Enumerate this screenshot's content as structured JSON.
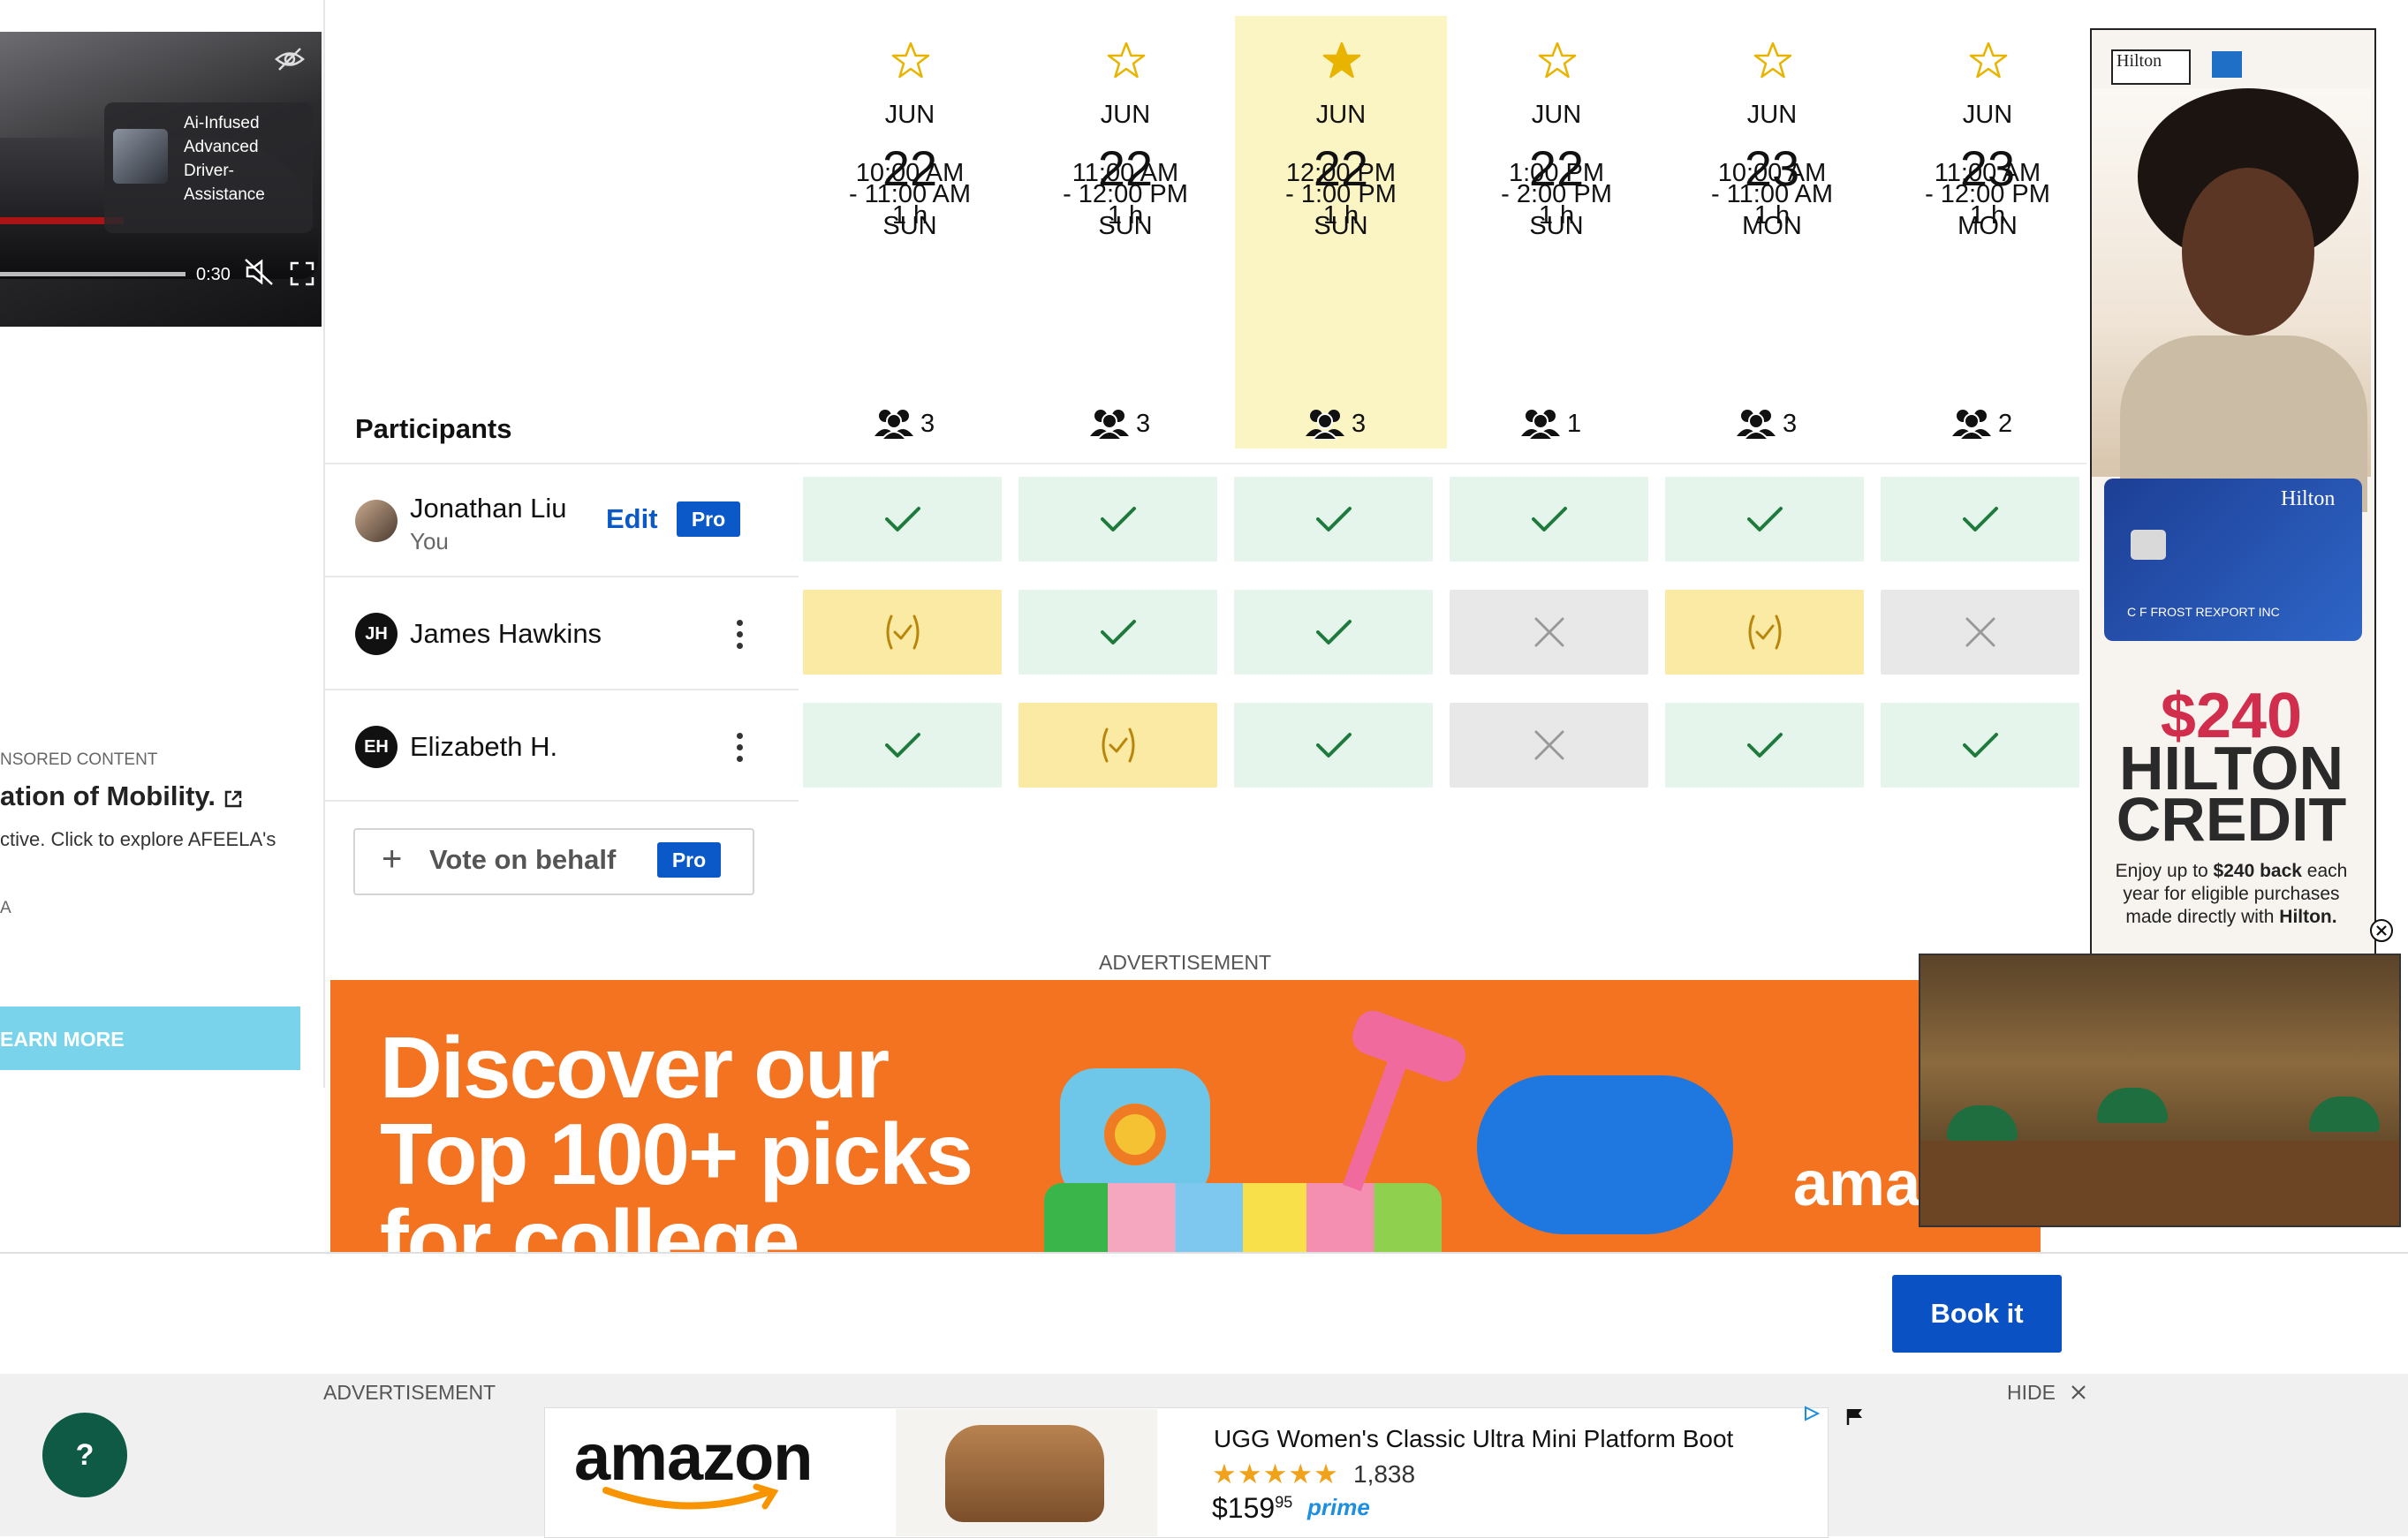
{
  "left_ad": {
    "video_caption": "Ai-Infused Advanced Driver-Assistance",
    "video_time": "0:30",
    "sponsored_label": "NSORED CONTENT",
    "headline": "ation of Mobility.",
    "description": "ctive. Click to explore AFEELA's",
    "brand_fragment": "A",
    "cta": "EARN MORE"
  },
  "participants": {
    "heading": "Participants",
    "rows": [
      {
        "initials": "",
        "name": "Jonathan Liu",
        "subtitle": "You",
        "edit_label": "Edit",
        "pro_label": "Pro"
      },
      {
        "initials": "JH",
        "name": "James Hawkins"
      },
      {
        "initials": "EH",
        "name": "Elizabeth H."
      }
    ],
    "vote_behalf": {
      "plus": "+",
      "label": "Vote on behalf",
      "pro_label": "Pro"
    }
  },
  "slots": [
    {
      "month": "JUN",
      "day": "22",
      "weekday": "SUN",
      "time_start": "10:00 AM",
      "time_end": "- 11:00 AM",
      "duration": "1 h",
      "count": "3",
      "starred": false,
      "highlighted": false
    },
    {
      "month": "JUN",
      "day": "22",
      "weekday": "SUN",
      "time_start": "11:00 AM",
      "time_end": "- 12:00 PM",
      "duration": "1 h",
      "count": "3",
      "starred": false,
      "highlighted": false
    },
    {
      "month": "JUN",
      "day": "22",
      "weekday": "SUN",
      "time_start": "12:00 PM",
      "time_end": "- 1:00 PM",
      "duration": "1 h",
      "count": "3",
      "starred": true,
      "highlighted": true
    },
    {
      "month": "JUN",
      "day": "22",
      "weekday": "SUN",
      "time_start": "1:00 PM",
      "time_end": "- 2:00 PM",
      "duration": "1 h",
      "count": "1",
      "starred": false,
      "highlighted": false
    },
    {
      "month": "JUN",
      "day": "23",
      "weekday": "MON",
      "time_start": "10:00 AM",
      "time_end": "- 11:00 AM",
      "duration": "1 h",
      "count": "3",
      "starred": false,
      "highlighted": false
    },
    {
      "month": "JUN",
      "day": "23",
      "weekday": "MON",
      "time_start": "11:00 AM",
      "time_end": "- 12:00 PM",
      "duration": "1 h",
      "count": "2",
      "starred": false,
      "highlighted": false
    }
  ],
  "votes": [
    [
      "yes",
      "yes",
      "yes",
      "yes",
      "yes",
      "yes"
    ],
    [
      "maybe",
      "yes",
      "yes",
      "no",
      "maybe",
      "no"
    ],
    [
      "yes",
      "maybe",
      "yes",
      "no",
      "yes",
      "yes"
    ]
  ],
  "colors": {
    "accent": "#0b59c8",
    "star": "#e8b400",
    "yes_check": "#1f7a3d",
    "maybe_mark": "#b8860b",
    "no_mark": "#999999",
    "highlight": "#fbf4c3"
  },
  "right_ad": {
    "logo": "Hilton",
    "card_brand": "Hilton",
    "card_name": "C F FROST REXPORT INC",
    "amount": "$240",
    "line1": "HILTON",
    "line2": "CREDIT",
    "desc_pre": "Enjoy up to ",
    "desc_bold": "$240 back",
    "desc_mid": " each year for eligible purchases made directly with ",
    "desc_bold2": "Hilton."
  },
  "middle_ad": {
    "label": "ADVERTISEMENT",
    "line1": "Discover our",
    "line2": "Top 100+ picks",
    "line3": "for college",
    "brand": "amaz"
  },
  "action_bar": {
    "book_it": "Book it"
  },
  "bottom_ad": {
    "label": "ADVERTISEMENT",
    "hide": "HIDE",
    "brand": "amazon",
    "product_title": "UGG Women's Classic Ultra Mini Platform Boot",
    "stars": "★★★★★",
    "rating": 4.5,
    "rating_count": "1,838",
    "price": "$159",
    "price_cents": "95",
    "prime": "prime"
  },
  "help_button": "?"
}
